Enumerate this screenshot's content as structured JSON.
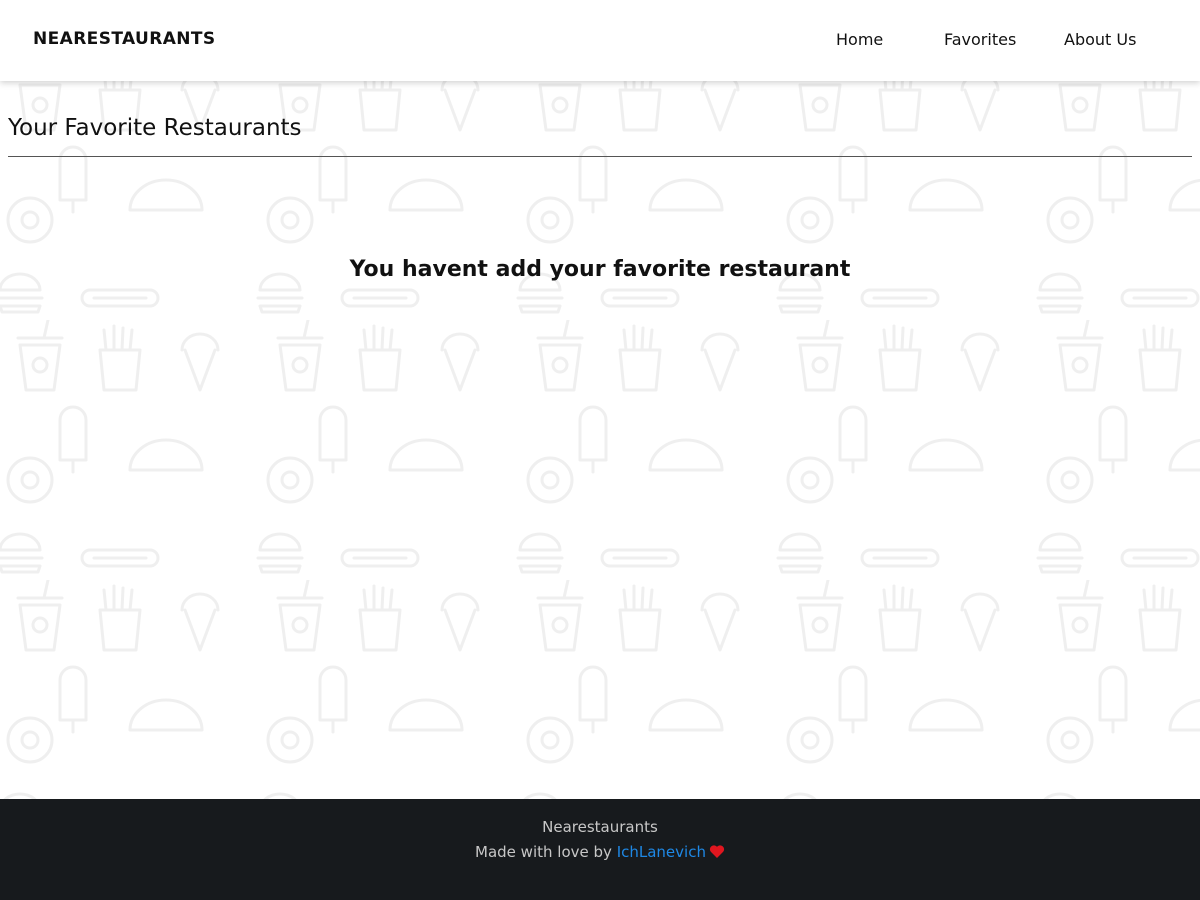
{
  "brand": "NEARESTAURANTS",
  "nav": {
    "home": "Home",
    "favorites": "Favorites",
    "about": "About Us"
  },
  "main": {
    "title": "Your Favorite Restaurants",
    "empty_message": "You havent add your favorite restaurant"
  },
  "footer": {
    "name": "Nearestaurants",
    "credit_prefix": "Made with love by",
    "author": "IchLanevich"
  },
  "colors": {
    "footer_bg": "#171a1d",
    "link": "#1e88e5",
    "heart": "#e0161f"
  },
  "icons": [
    "food-pattern",
    "heart-icon"
  ]
}
